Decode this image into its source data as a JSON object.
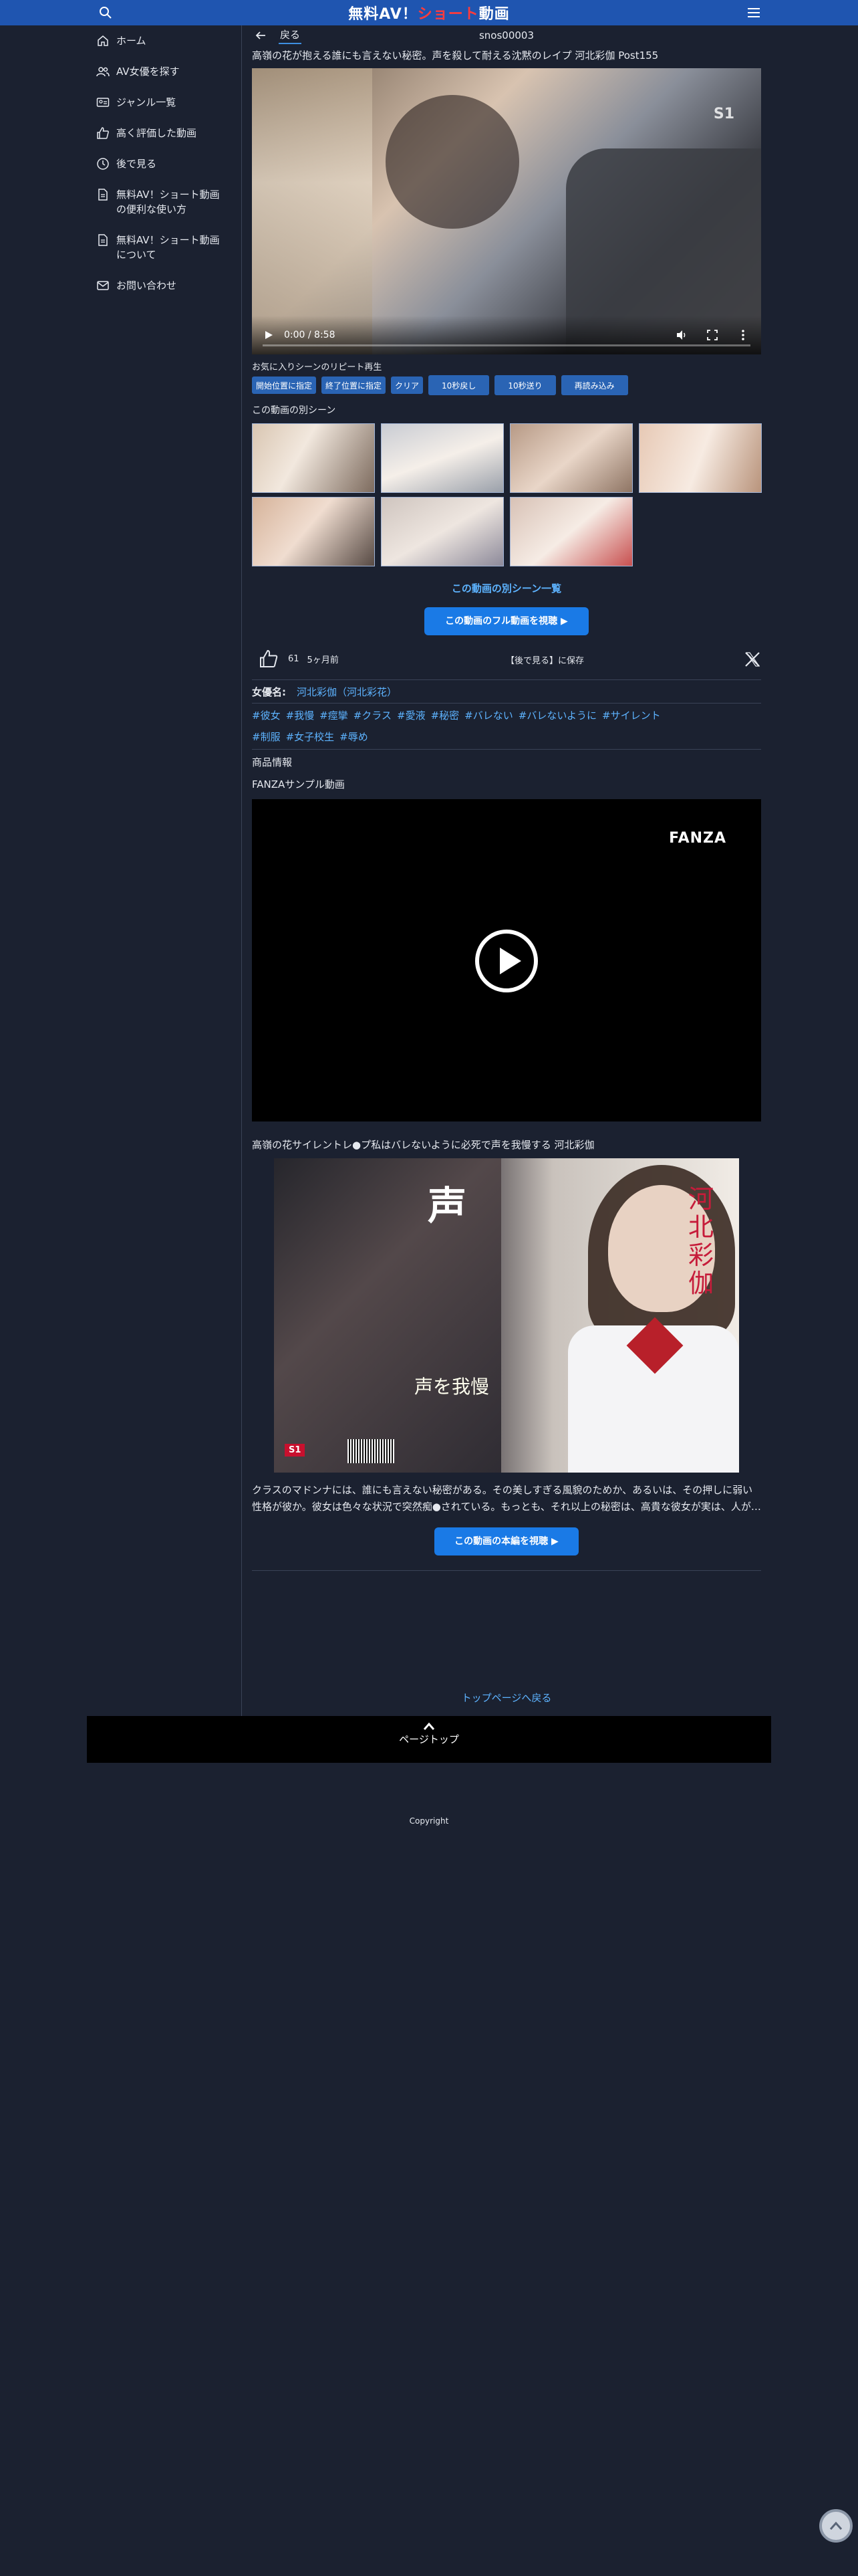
{
  "header": {
    "brand_part1": "無料AV！",
    "brand_part2": "ショート",
    "brand_part3": "動画",
    "brand_accent": "#ff3b3b",
    "bar_color": "#1f55b0"
  },
  "sidebar": {
    "items": [
      {
        "label": "ホーム",
        "icon": "home-icon"
      },
      {
        "label": "AV女優を探す",
        "icon": "users-icon"
      },
      {
        "label": "ジャンル一覧",
        "icon": "id-card-icon"
      },
      {
        "label": "高く評価した動画",
        "icon": "thumbs-up-icon"
      },
      {
        "label": "後で見る",
        "icon": "clock-icon"
      },
      {
        "label": "無料AV！ショート動画\nの便利な使い方",
        "icon": "document-icon"
      },
      {
        "label": "無料AV！ショート動画\nについて",
        "icon": "document-icon"
      },
      {
        "label": "お問い合わせ",
        "icon": "mail-icon"
      }
    ]
  },
  "subhead": {
    "back": "戻る",
    "code": "snos00003"
  },
  "video": {
    "title": "高嶺の花が抱える誰にも言えない秘密。声を殺して耐える沈黙のレイプ 河北彩伽 Post155",
    "time": "0:00 / 8:58"
  },
  "repeat": {
    "title": "お気に入りシーンのリピート再生",
    "buttons": [
      "開始位置に指定",
      "終了位置に指定",
      "クリア"
    ],
    "wide_buttons": [
      "10秒戻し",
      "10秒送り",
      "再読み込み"
    ]
  },
  "scenes": {
    "title": "この動画の別シーン",
    "list_link": "この動画の別シーン一覧",
    "full_button": " この動画のフル動画を視聴 ▶"
  },
  "social": {
    "likes": "61",
    "ago": "5ヶ月前",
    "watch_later": "【後で見る】に保存"
  },
  "meta": {
    "actress_label": "女優名:",
    "actress_name": "河北彩伽（河北彩花）",
    "tags": [
      "#彼女",
      "#我慢",
      "#痙攣",
      "#クラス",
      "#愛液",
      "#秘密",
      "#バレない",
      "#バレないように",
      "#サイレント",
      "#制服",
      "#女子校生",
      "#辱め"
    ],
    "info_title": "商品情報",
    "fanza_title": "FANZAサンプル動画",
    "fanza_logo": "FANZA",
    "package_title": "高嶺の花サイレントレ●プ私はバレないように必死で声を我慢する 河北彩伽",
    "description": "クラスのマドンナには、誰にも言えない秘密がある。その美しすぎる風貌のためか、あるいは、その押しに弱い性格が彼か。彼女は色々な状況で突然痴●されている。もっとも、それ以上の秘密は、高貴な彼女が実は、人が…",
    "main_button": " この動画の本編を視聴 ▶"
  },
  "footer": {
    "top_link": "トップページへ戻る",
    "page_top": "ページトップ",
    "copyright": "Copyright"
  }
}
